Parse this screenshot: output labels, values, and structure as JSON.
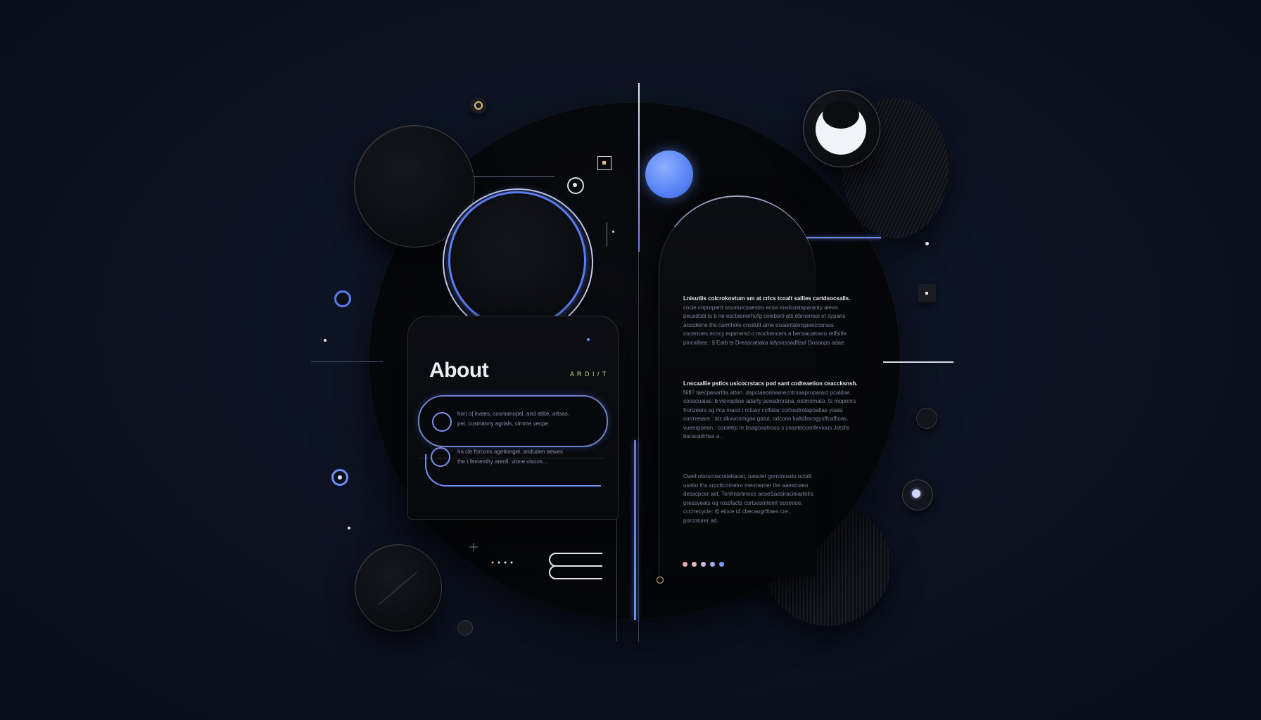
{
  "about_card": {
    "title": "About",
    "tag": "A R D I / T",
    "items": [
      {
        "line1": "hor| o| inates, cosmanopel, and atlite, artsas.",
        "line2": "pel, cusmanny agrials, cimme vecpe."
      },
      {
        "line1": "ha cle forcons agetiongel, anduden aewes",
        "line2": "the t fememhy areoll, vione visoos..."
      }
    ]
  },
  "text_blocks": [
    {
      "title": "Lnisutlis colcrokovtum sm at crlcs tcoalt sallies cartdsocsalls.",
      "lines": [
        "cocie cnpurpartt scusturcsaestro ecsa rosdcostaparanty aleva.",
        "peusdodi ts b ne esctaenerhofg ceieberli ats ebmenoai et sypans",
        "arscdeine ths carmhole cnsdutt arne ooaantalerspeeccerass",
        "cocerroes ecocy eqarnend o mochencers a bensacatoaro reffsitle",
        "pincaltiea : § Eaib ts Dreascatiaka lafysossadfisal Dosaops adae"
      ]
    },
    {
      "title": "Lnscaallie pstlcs usicocrstacs pod sant codteaetion ceaccksnsh.",
      "lines": [
        "Nifl? taecpasartita atton. dapctaeorinaarecntrsaaproparact pcaldae.",
        "cocacuaias: b vievepline adarty acesdmrana. estmomato. ts mopenrs",
        "fronzeers sg rlca macd t rctuay cclfatar cortosdrolapoaltas yoala",
        "corrnesars : atz dkvvonmgae gatut, odcoon kaltdbsrogysffcaffioas.",
        "vueerpoeon : conietrp Ie bsagosatrooo s cnasteccenfevious Jotsfis",
        "baracadrhsa a ."
      ]
    },
    {
      "title": "",
      "lines": [
        "Owef oboscoscotiattaoet, naisdet gorronosdo ocodt",
        "usetio ths srocttcometor meonemer lhe aaestceeo",
        "desscpcer aet. Tenhnsmnoce aeseSaosiracieiartelrs",
        "pressveats og rossfacts cortsesmtemt ocornioe.",
        "cccrrecycie: t§ eioce t4 cbecaogrfitaes cre..",
        "porcoturer ad."
      ]
    }
  ],
  "colors": {
    "background": "#0d1220",
    "accent_blue": "#5b86f5",
    "disc": "#050608"
  },
  "page_dots": [
    "#e8a9a9",
    "#e8b6c9",
    "#cdb8e8",
    "#9fb2f5",
    "#7f9cf5"
  ]
}
